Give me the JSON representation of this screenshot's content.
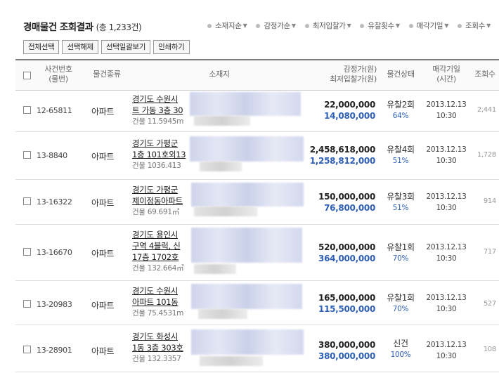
{
  "header": {
    "title": "경매물건 조회결과",
    "total": "(총 1,233건)",
    "sort_options": [
      "소재지순",
      "감정가순",
      "최저입찰가",
      "유찰횟수",
      "매각기일",
      "조회수"
    ]
  },
  "buttons": {
    "select_all": "전체선택",
    "deselect": "선택해제",
    "view_selected": "선택일괄보기",
    "print": "인쇄하기"
  },
  "columns": {
    "case_no": "사건번호",
    "case_sub": "(물번)",
    "kind": "물건종류",
    "location": "소재지",
    "price1": "감정가(원)",
    "price2": "최저입찰가(원)",
    "status": "물건상태",
    "date1": "매각기일",
    "date2": "(시간)",
    "views": "조회수"
  },
  "rows": [
    {
      "case_no": "12-65811",
      "kind": "아파트",
      "loc1": "경기도 수원시",
      "loc2": "트 가동 3층 30",
      "loc3": "건물 11.5945m",
      "appraisal": "22,000,000",
      "min_bid": "14,080,000",
      "status": "유찰2회",
      "pct": "64%",
      "date": "2013.12.13",
      "time": "10:30",
      "views": "2,441"
    },
    {
      "case_no": "13-8840",
      "kind": "아파트",
      "loc1": "경기도 가평군",
      "loc2": "1층 101호외13",
      "loc3": "건물 1036.413",
      "appraisal": "2,458,618,000",
      "min_bid": "1,258,812,000",
      "status": "유찰4회",
      "pct": "51%",
      "date": "2013.12.13",
      "time": "10:30",
      "views": "1,728"
    },
    {
      "case_no": "13-16322",
      "kind": "아파트",
      "loc1": "경기도 가평군",
      "loc2": "제이정동아파트",
      "loc3": "건물 69.691㎡",
      "appraisal": "150,000,000",
      "min_bid": "76,800,000",
      "status": "유찰3회",
      "pct": "51%",
      "date": "2013.12.13",
      "time": "10:30",
      "views": "914"
    },
    {
      "case_no": "13-16670",
      "kind": "아파트",
      "loc1": "경기도 용인시",
      "loc2": "구역 4블럭, 신",
      "loc2b": "17층 1702호",
      "loc3": "건물 132.664㎡",
      "appraisal": "520,000,000",
      "min_bid": "364,000,000",
      "status": "유찰1회",
      "pct": "70%",
      "date": "2013.12.13",
      "time": "10:30",
      "views": "717"
    },
    {
      "case_no": "13-20983",
      "kind": "아파트",
      "loc1": "경기도 수원시",
      "loc2": "아파트 101동",
      "loc3": "건물 75.4531m",
      "appraisal": "165,000,000",
      "min_bid": "115,500,000",
      "status": "유찰1회",
      "pct": "70%",
      "date": "2013.12.13",
      "time": "10:30",
      "views": "527"
    },
    {
      "case_no": "13-28901",
      "kind": "아파트",
      "loc1": "경기도 화성시",
      "loc2": "1동 3층 303호",
      "loc3": "건물 132.3357",
      "appraisal": "380,000,000",
      "min_bid": "380,000,000",
      "status": "신건",
      "pct": "100%",
      "date": "2013.12.13",
      "time": "10:30",
      "views": "108"
    }
  ]
}
